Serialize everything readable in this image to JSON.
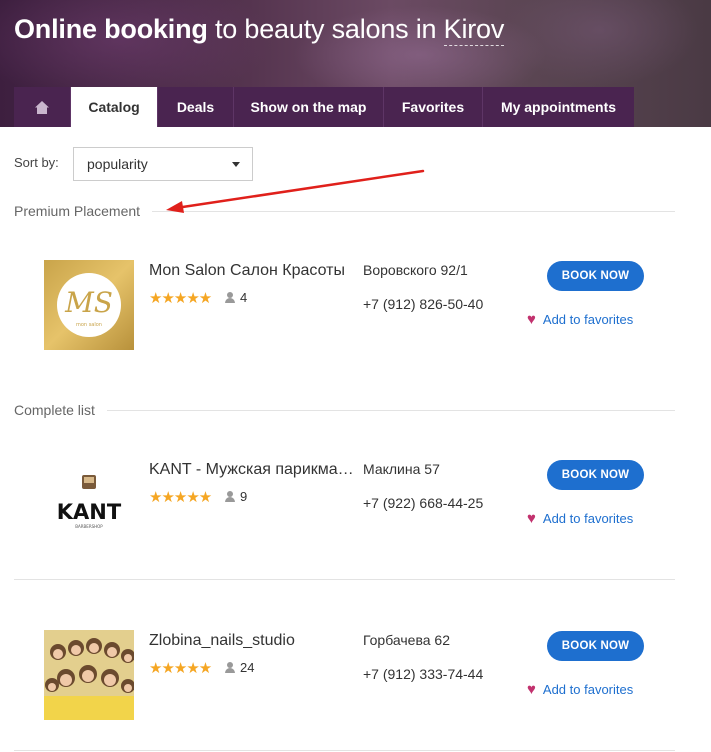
{
  "header": {
    "title_bold": "Online booking",
    "title_rest": " to beauty salons in ",
    "city": "Kirov"
  },
  "tabs": [
    {
      "label": "",
      "icon": "home-icon"
    },
    {
      "label": "Catalog",
      "active": true
    },
    {
      "label": "Deals"
    },
    {
      "label": "Show on the map"
    },
    {
      "label": "Favorites"
    },
    {
      "label": "My appointments"
    }
  ],
  "sort": {
    "label": "Sort by:",
    "value": "popularity"
  },
  "sections": {
    "premium": "Premium Placement",
    "complete": "Complete list"
  },
  "book_label": "BOOK NOW",
  "favorites_label": "Add to favorites",
  "salons": [
    {
      "name": "Mon Salon Салон Красоты",
      "stars": "★★★★★",
      "reviews": "4",
      "address": "Воровского 92/1",
      "phone": "+7 (912) 826-50-40",
      "logo_text": "MS",
      "logo_caption": "mon salon"
    },
    {
      "name": "KANT - Мужская парикмахерская",
      "stars": "★★★★★",
      "reviews": "9",
      "address": "Маклина 57",
      "phone": "+7 (922) 668-44-25",
      "logo_text": "KANT",
      "logo_caption": "BARBERSHOP"
    },
    {
      "name": "Zlobina_nails_studio",
      "stars": "★★★★★",
      "reviews": "24",
      "address": "Горбачева 62",
      "phone": "+7 (912) 333-74-44"
    }
  ],
  "colors": {
    "tab_bg": "#4a2450",
    "button": "#1e6fcf",
    "star": "#f5a623",
    "heart": "#c2326e",
    "arrow": "#e0201b"
  }
}
